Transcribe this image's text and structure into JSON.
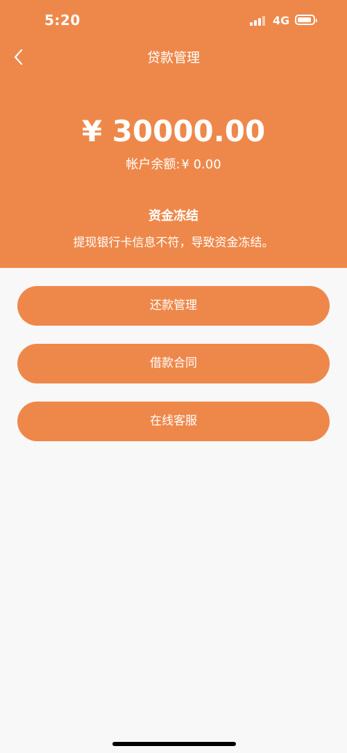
{
  "status_bar": {
    "time": "5:20",
    "network": "4G",
    "icons": [
      "signal-icon",
      "battery-icon"
    ]
  },
  "nav": {
    "back_icon": "chevron-left-icon",
    "title": "贷款管理"
  },
  "summary": {
    "amount": "¥ 30000.00",
    "balance_label": "帐户余额:",
    "balance_value": "¥ 0.00",
    "status_title": "资金冻结",
    "status_message": "提现银行卡信息不符，导致资金冻结。"
  },
  "actions": {
    "repay_label": "还款管理",
    "contract_label": "借款合同",
    "service_label": "在线客服"
  },
  "colors": {
    "accent": "#ee884a",
    "background": "#f8f8f8",
    "text_on_accent": "#ffffff"
  }
}
